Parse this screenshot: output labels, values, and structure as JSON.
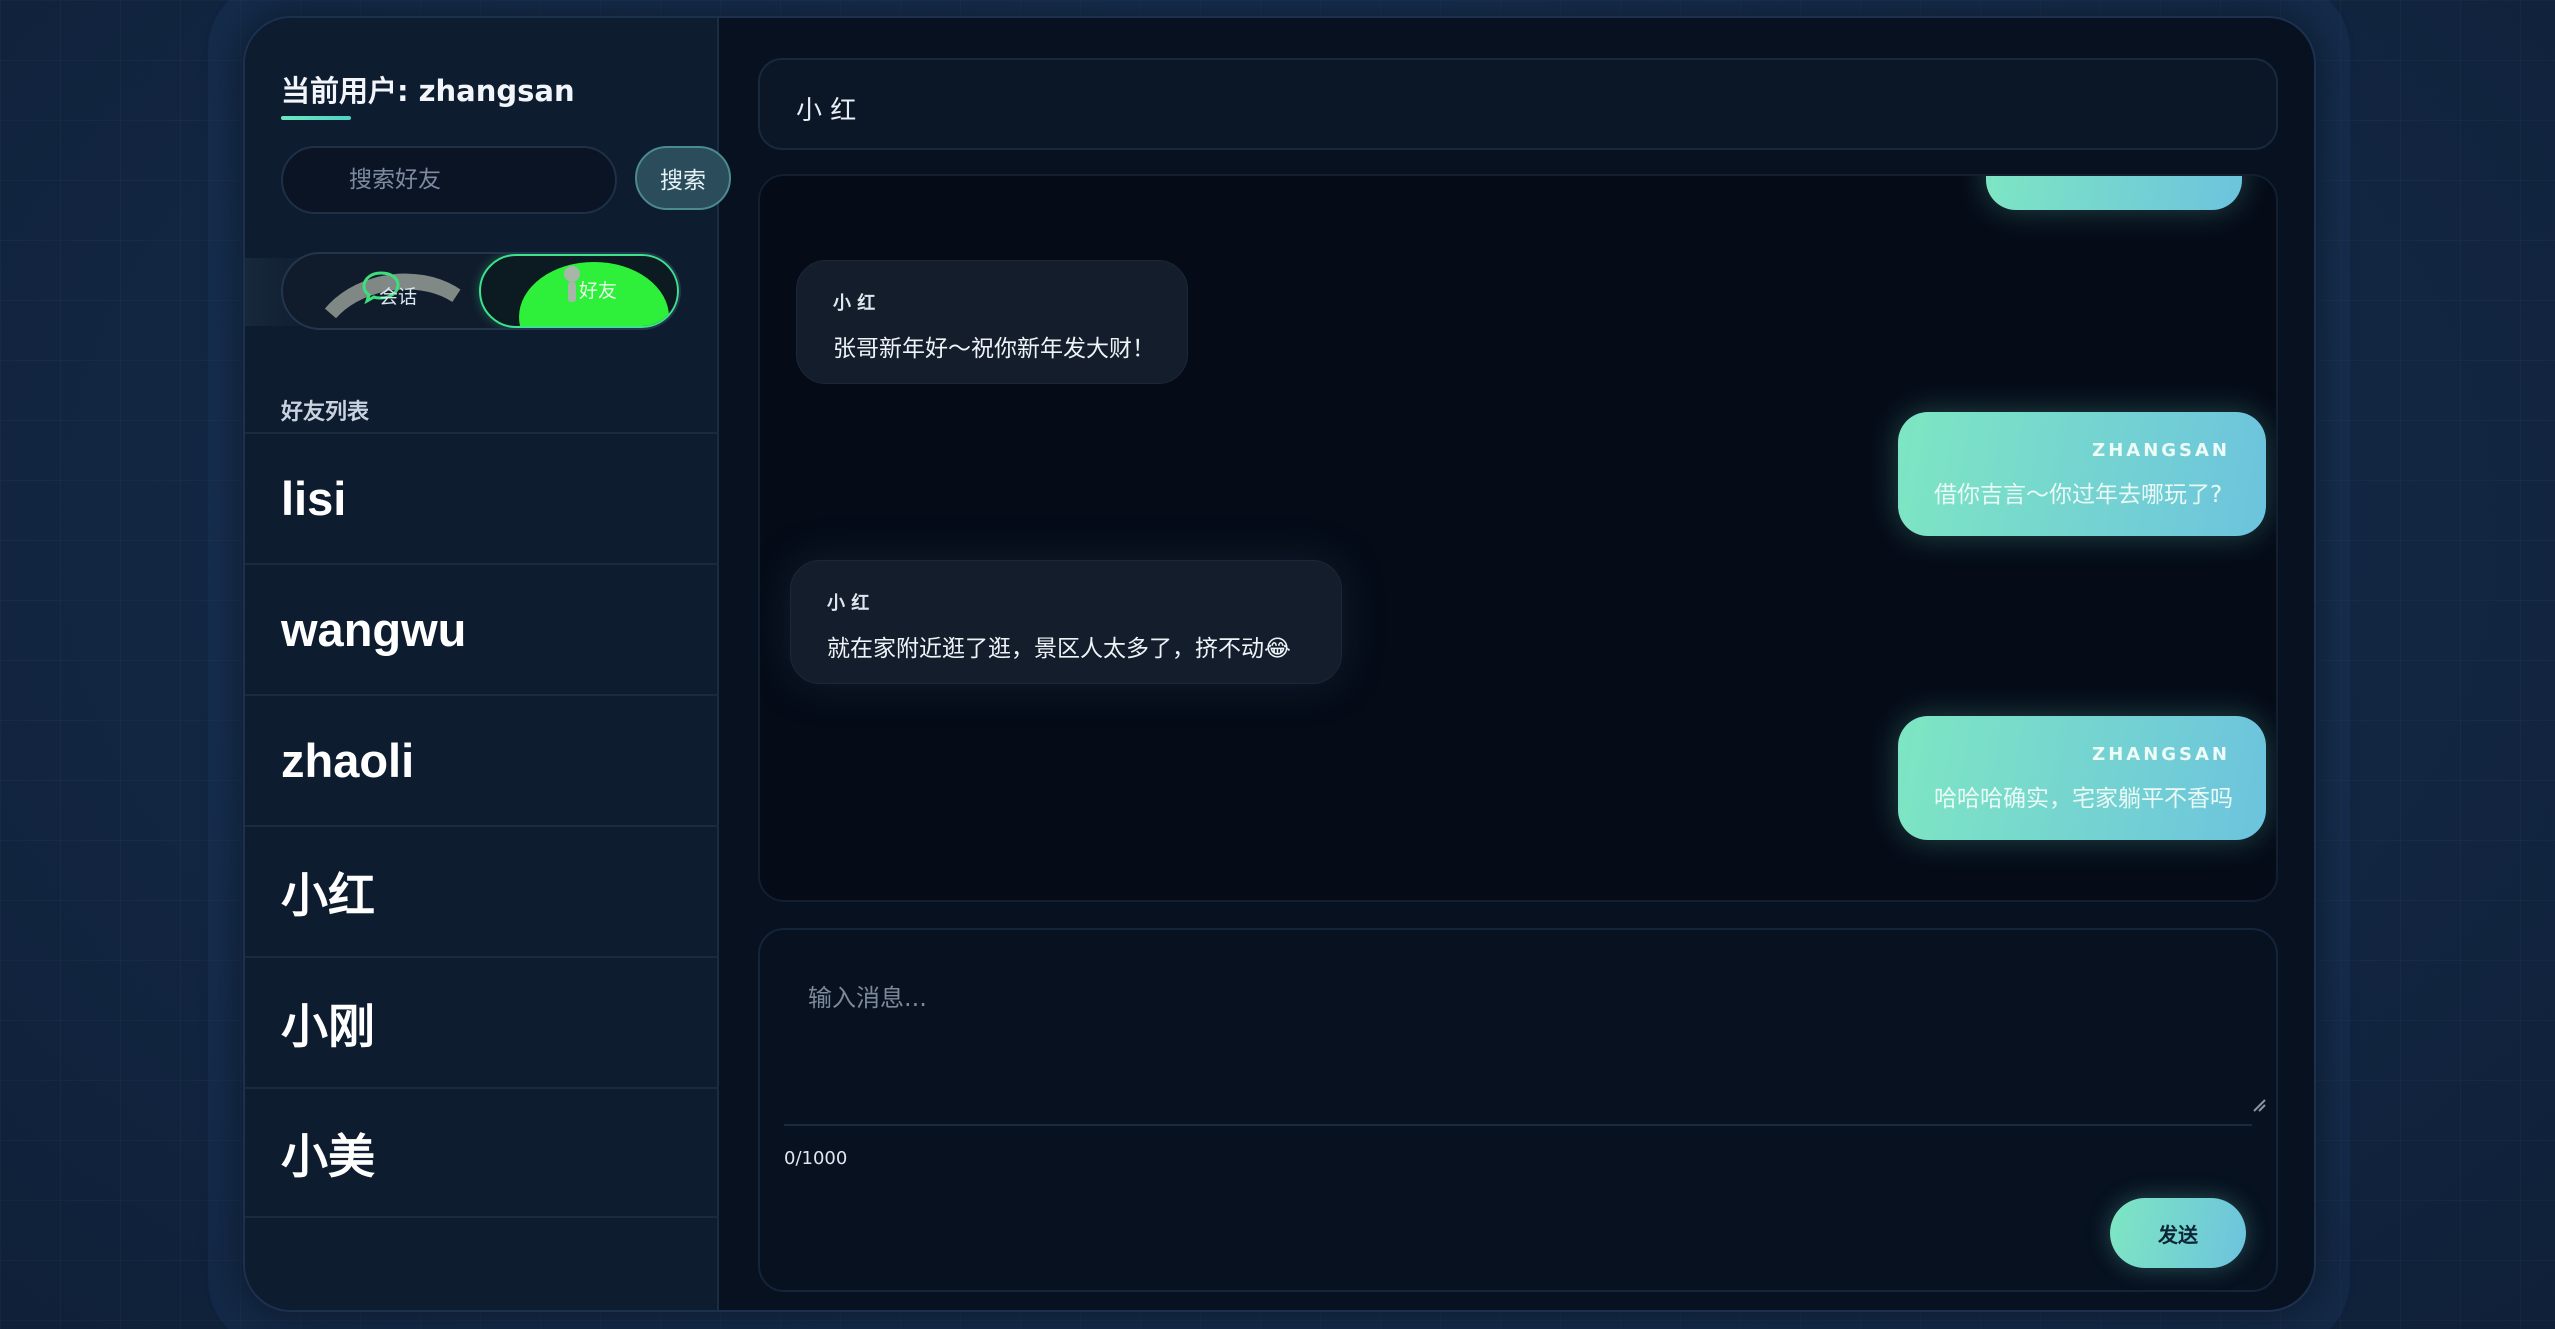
{
  "sidebar": {
    "current_user_label": "当前用户:",
    "current_user_name": "zhangsan",
    "search_placeholder": "搜索好友",
    "search_button": "搜索",
    "tabs": {
      "chats": "会话",
      "friends": "好友"
    },
    "friends_heading": "好友列表",
    "friends": [
      "lisi",
      "wangwu",
      "zhaoli",
      "小红",
      "小刚",
      "小美"
    ]
  },
  "chat": {
    "title": "小 红",
    "messages": [
      {
        "direction": "in",
        "sender": "小 红",
        "text": "张哥新年好～祝你新年发大财！"
      },
      {
        "direction": "out",
        "sender": "ZHANGSAN",
        "text": "借你吉言～你过年去哪玩了?"
      },
      {
        "direction": "in",
        "sender": "小 红",
        "text": "就在家附近逛了逛，景区人太多了，挤不动😂"
      },
      {
        "direction": "out",
        "sender": "ZHANGSAN",
        "text": "哈哈哈确实，宅家躺平不香吗"
      }
    ]
  },
  "composer": {
    "placeholder": "输入消息...",
    "char_count": "0/1000",
    "send_label": "发送"
  },
  "colors": {
    "accent_gradient_start": "#7ee6c2",
    "accent_gradient_end": "#6cc3de",
    "friends_tab_active": "#2ef03a"
  },
  "icons": [
    "chat-bubble-icon",
    "user-icon",
    "resize-handle-icon"
  ]
}
